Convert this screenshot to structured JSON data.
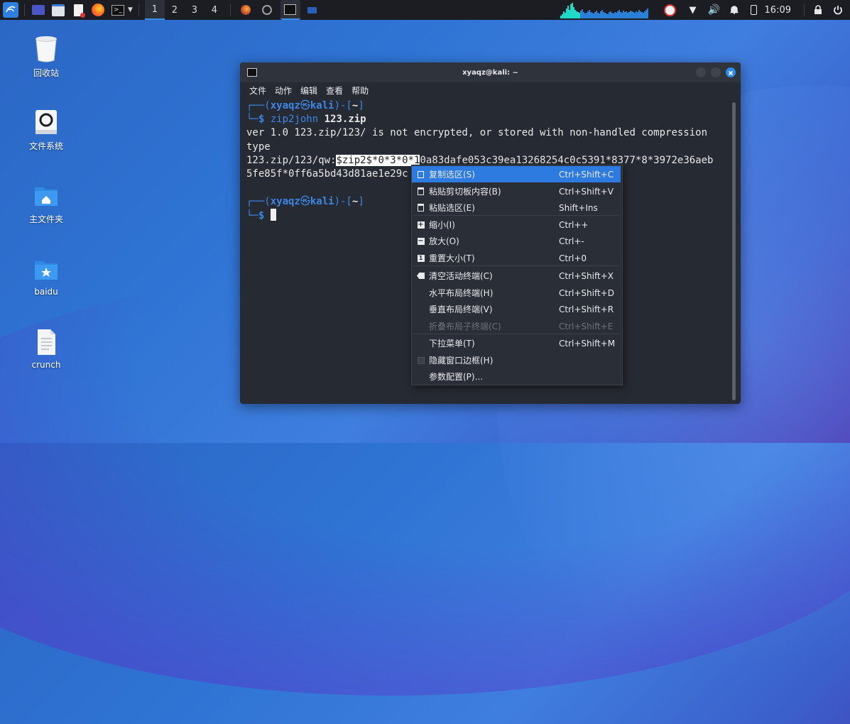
{
  "taskbar": {
    "workspaces": [
      "1",
      "2",
      "3",
      "4"
    ],
    "clock": "16:09"
  },
  "desktop": {
    "icons": [
      {
        "label": "回收站",
        "icon": "trash-icon"
      },
      {
        "label": "文件系统",
        "icon": "drive-icon"
      },
      {
        "label": "主文件夹",
        "icon": "home-folder-icon"
      },
      {
        "label": "baidu",
        "icon": "bookmark-folder-icon"
      },
      {
        "label": "crunch",
        "icon": "text-file-icon"
      }
    ]
  },
  "terminal": {
    "title": "xyaqz@kali: ~",
    "menu": [
      "文件",
      "动作",
      "编辑",
      "查看",
      "帮助"
    ],
    "prompt_user": "xyaqz",
    "prompt_at": "㉿",
    "prompt_host": "kali",
    "prompt_dir": "~",
    "prompt_symbol": "$",
    "cmd1": "zip2john",
    "cmd1_arg": "123.zip",
    "out1": "ver 1.0 123.zip/123/ is not encrypted, or stored with non-handled compression",
    "out2": "type",
    "out3_pre": "123.zip/123/qw:",
    "out3_sel": "$zip2$*0*3*0*1",
    "out3_post": "0a83dafe053c39ea13268254c0c5391*8377*8*3972e36aeb",
    "out4": "5fe85f*0ff6a5bd43d81ae1e29c"
  },
  "context_menu": {
    "items": [
      {
        "label": "复制选区(S)",
        "shortcut": "Ctrl+Shift+C",
        "icon": "copy-icon"
      },
      {
        "label": "粘贴剪切板内容(B)",
        "shortcut": "Ctrl+Shift+V",
        "icon": "paste-icon"
      },
      {
        "label": "粘贴选区(E)",
        "shortcut": "Shift+Ins",
        "icon": "paste-selection-icon"
      },
      {
        "label": "缩小(I)",
        "shortcut": "Ctrl++",
        "icon": "zoom-out-icon"
      },
      {
        "label": "放大(O)",
        "shortcut": "Ctrl+-",
        "icon": "zoom-in-icon"
      },
      {
        "label": "重置大小(T)",
        "shortcut": "Ctrl+0",
        "icon": "reset-size-icon"
      },
      {
        "label": "清空活动终端(C)",
        "shortcut": "Ctrl+Shift+X",
        "icon": "clear-icon"
      },
      {
        "label": "水平布局终端(H)",
        "shortcut": "Ctrl+Shift+D",
        "icon": ""
      },
      {
        "label": "垂直布局终端(V)",
        "shortcut": "Ctrl+Shift+R",
        "icon": ""
      },
      {
        "label": "折叠布局子终端(C)",
        "shortcut": "Ctrl+Shift+E",
        "icon": ""
      },
      {
        "label": "下拉菜单(T)",
        "shortcut": "Ctrl+Shift+M",
        "icon": ""
      },
      {
        "label": "隐藏窗口边框(H)",
        "shortcut": "",
        "icon": "checkbox-icon"
      },
      {
        "label": "参数配置(P)...",
        "shortcut": "",
        "icon": ""
      }
    ]
  }
}
